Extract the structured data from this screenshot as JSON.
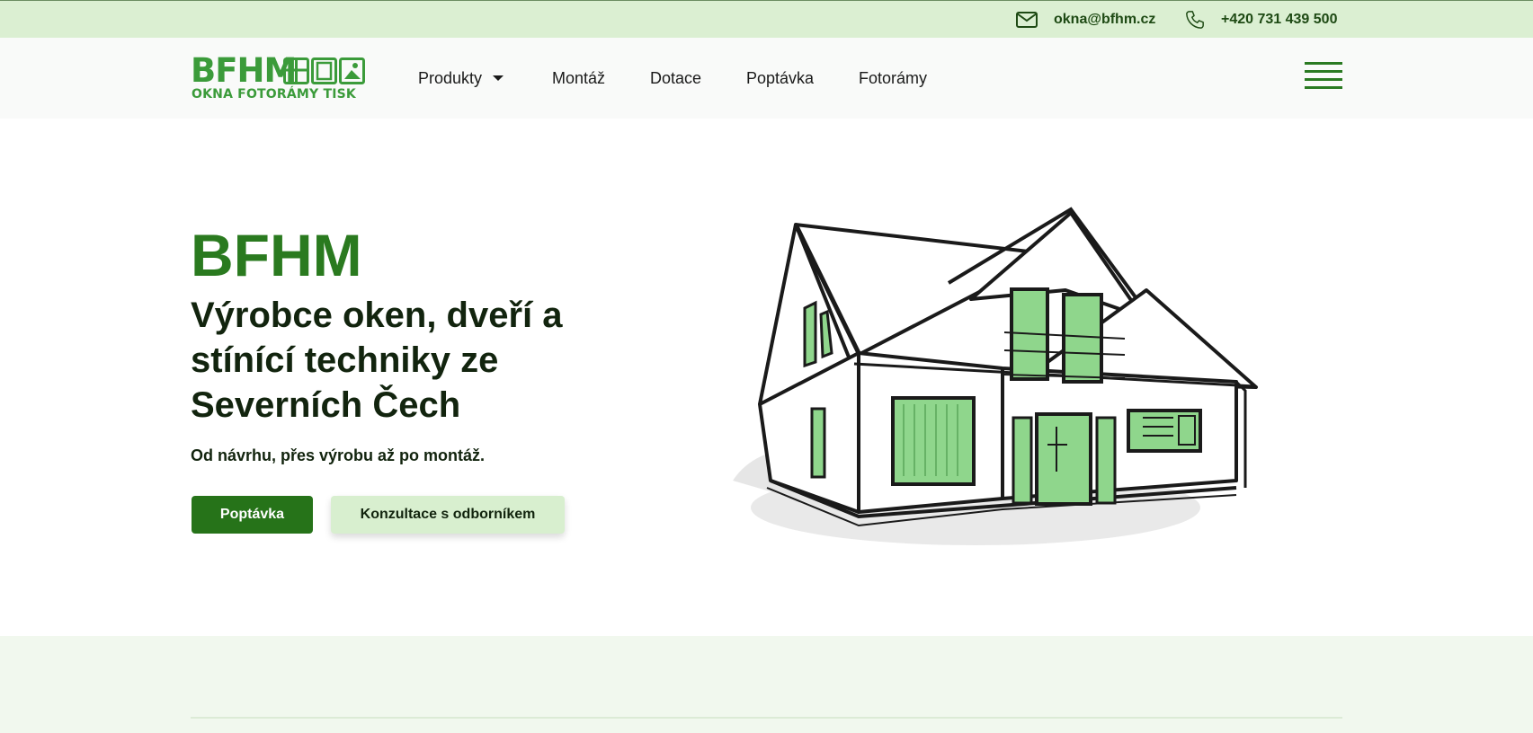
{
  "topbar": {
    "email": "okna@bfhm.cz",
    "phone": "+420 731 439 500",
    "email_icon": "envelope-icon",
    "phone_icon": "phone-icon"
  },
  "logo": {
    "word": "BFHM",
    "tagline": "OKNA FOTORÁMY TISK"
  },
  "nav": {
    "items": [
      {
        "label": "Produkty",
        "has_dropdown": true
      },
      {
        "label": "Montáž"
      },
      {
        "label": "Dotace"
      },
      {
        "label": "Poptávka"
      },
      {
        "label": "Fotorámy"
      }
    ],
    "menu_icon": "hamburger-icon"
  },
  "hero": {
    "brand": "BFHM",
    "title": "Výrobce oken, dveří a stínící techniky ze Severních Čech",
    "subtitle": "Od návrhu, přes výrobu až po montáž.",
    "primary_button": "Poptávka",
    "secondary_button": "Konzultace s odborníkem",
    "illustration_icon": "house-illustration-icon"
  },
  "colors": {
    "brand_green": "#2a7a1f",
    "logo_green": "#3b9b3a",
    "topbar_bg": "#dbefd2",
    "button_primary": "#267319",
    "button_secondary": "#d8efcf",
    "window_fill": "#8fd68c"
  }
}
